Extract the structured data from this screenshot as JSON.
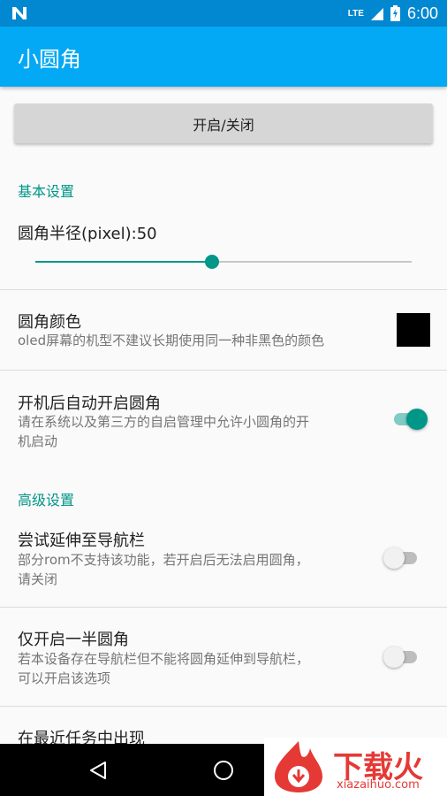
{
  "status_bar": {
    "network": "LTE",
    "time": "6:00"
  },
  "app_bar": {
    "title": "小圆角"
  },
  "toggle_button": {
    "label": "开启/关闭"
  },
  "basic_settings": {
    "header": "基本设置",
    "radius": {
      "label": "圆角半径(pixel):50",
      "slider_fraction": 0.47
    },
    "color": {
      "title": "圆角颜色",
      "summary": "oled屏幕的机型不建议长期使用同一种非黑色的颜色",
      "swatch_color": "#000000"
    },
    "autostart": {
      "title": "开机后自动开启圆角",
      "summary_line1": "请在系统以及第三方的自启管理中允许小圆角的开",
      "summary_line2": "机启动",
      "enabled": true
    }
  },
  "advanced_settings": {
    "header": "高级设置",
    "extend_navbar": {
      "title": "尝试延伸至导航栏",
      "summary_line1": "部分rom不支持该功能，若开启后无法启用圆角，",
      "summary_line2": "请关闭",
      "enabled": false
    },
    "half_corners": {
      "title": "仅开启一半圆角",
      "summary_line1": "若本设备存在导航栏但不能将圆角延伸到导航栏，",
      "summary_line2": "可以开启该选项",
      "enabled": false
    },
    "recents": {
      "title": "在最近任务中出现"
    }
  },
  "watermark": {
    "text": "下载火",
    "url": "xiazaihuo.com"
  },
  "colors": {
    "status_bar": "#0288d1",
    "app_bar": "#03a9f4",
    "accent": "#009688"
  }
}
